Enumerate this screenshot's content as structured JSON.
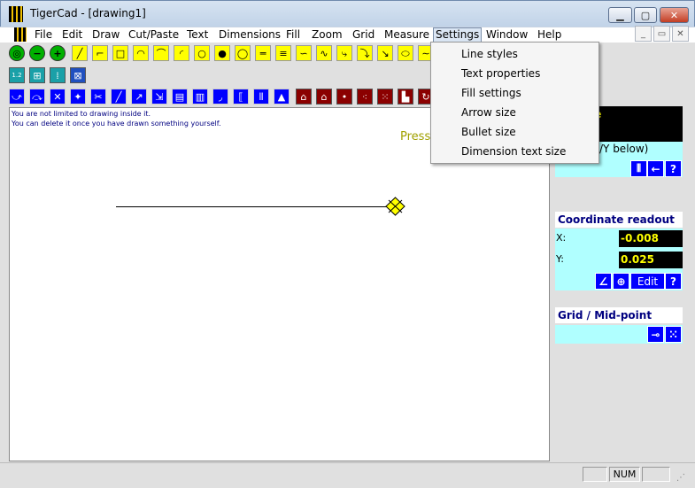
{
  "window": {
    "title": "TigerCad - [drawing1]",
    "min": "▁",
    "max": "▢",
    "close": "✕"
  },
  "menu": {
    "items": [
      "File",
      "Edit",
      "Draw",
      "Cut/Paste",
      "Text",
      "Dimensions",
      "Fill",
      "Zoom",
      "Grid",
      "Measure",
      "Settings",
      "Window",
      "Help"
    ],
    "mdi": {
      "min": "_",
      "restore": "▭",
      "close": "✕"
    }
  },
  "settings_menu": {
    "items": [
      "Line styles",
      "Text properties",
      "Fill settings",
      "Arrow size",
      "Bullet size",
      "Dimension text size"
    ]
  },
  "canvas": {
    "hint_line1": "You are not limited to drawing inside it.",
    "hint_line2": "You can delete it once you have drawn something yourself.",
    "press_text": "Press"
  },
  "right_panel": {
    "tool_line1": "ctangle",
    "tool_line2": "art",
    "tool_hint": "/Y below)",
    "coord_title": "Coordinate readout",
    "x_label": "X:",
    "x_value": "-0.008",
    "y_label": "Y:",
    "y_value": "0.025",
    "edit_label": "Edit",
    "help_label": "?",
    "grid_title": "Grid / Mid-point"
  },
  "status": {
    "num": "NUM"
  },
  "colors": {
    "accent_blue": "#0000ff",
    "panel_cyan": "#b0ffff",
    "readout_yellow": "#ffff00"
  }
}
